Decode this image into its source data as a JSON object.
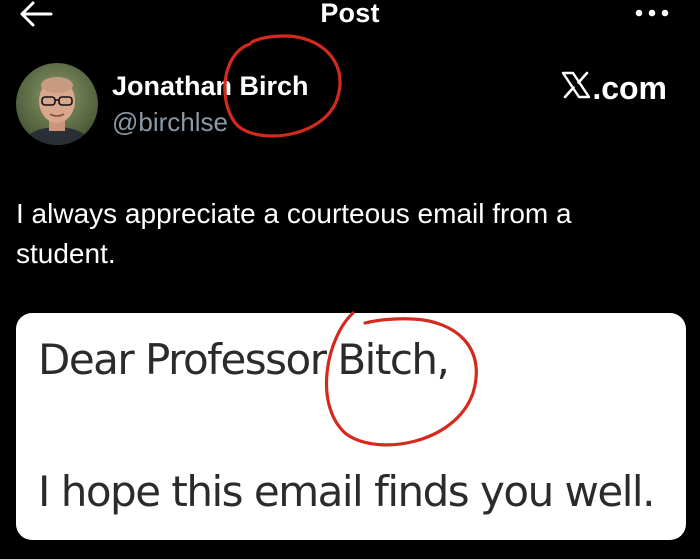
{
  "header": {
    "title": "Post",
    "back_icon": "arrow-left-icon",
    "more_icon": "more-horizontal-icon"
  },
  "author": {
    "name": "Jonathan Birch",
    "handle": "@birchlse",
    "avatar_icon": "profile-photo"
  },
  "brand": {
    "label": ".com",
    "logo_icon": "x-logo-icon"
  },
  "tweet": {
    "text": "I always appreciate a courteous email from a student."
  },
  "email_image": {
    "greeting": "Dear Professor Bitch,",
    "body": "I hope this email finds you well."
  },
  "annotation": {
    "circle_color": "#d42a1e"
  },
  "colors": {
    "background": "#000000",
    "text_primary": "#ffffff",
    "text_secondary": "#8b98a5"
  }
}
